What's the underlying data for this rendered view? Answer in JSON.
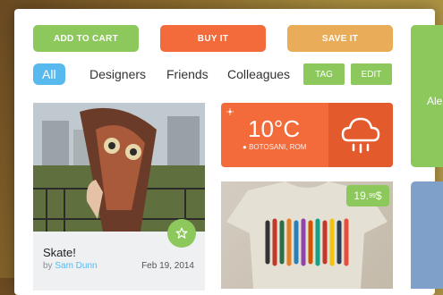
{
  "actions": {
    "add_to_cart": "ADD TO CART",
    "buy_it": "BUY IT",
    "save_it": "SAVE IT"
  },
  "filters": {
    "active": "All",
    "items": [
      "Designers",
      "Friends",
      "Colleagues"
    ],
    "tag": "TAG",
    "edit": "EDIT"
  },
  "post": {
    "title": "Skate!",
    "by": "by",
    "author": "Sam Dunn",
    "date": "Feb 19, 2014"
  },
  "weather": {
    "temperature": "10°C",
    "location": "BOTOSANI, ROM"
  },
  "product": {
    "price_main": "19.",
    "price_cents": "99",
    "currency": "$"
  },
  "side": {
    "partial_text": "Ale"
  },
  "colors": {
    "green": "#8cc85c",
    "orange": "#f36a3b",
    "gold": "#e9ad5a",
    "blue": "#58b9ef"
  }
}
